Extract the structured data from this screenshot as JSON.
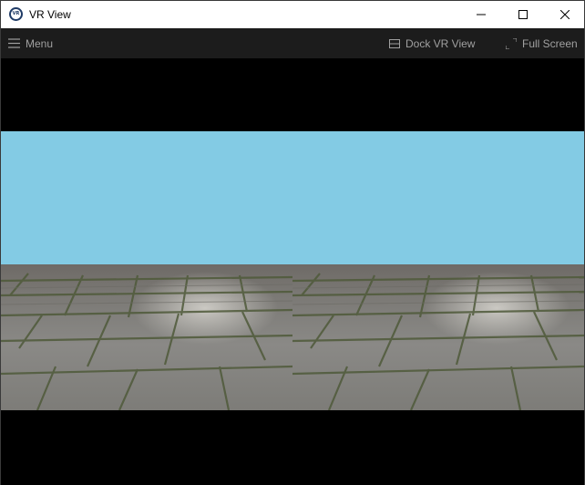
{
  "window": {
    "title": "VR View",
    "icon": "vr-app-icon",
    "icon_text": "VR",
    "controls": {
      "minimize": "minimize-icon",
      "maximize": "maximize-icon",
      "close": "close-icon"
    }
  },
  "toolbar": {
    "menu_label": "Menu",
    "menu_icon": "hamburger-icon",
    "dock_label": "Dock VR View",
    "dock_icon": "dock-icon",
    "fullscreen_label": "Full Screen",
    "fullscreen_icon": "fullscreen-icon"
  },
  "scene": {
    "layout": "side-by-side stereo",
    "eyes": [
      "left",
      "right"
    ],
    "sky_color": "#83cbe4",
    "ground": "stone paving with grass"
  },
  "colors": {
    "titlebar_bg": "#ffffff",
    "toolbar_bg": "#1c1c1c",
    "toolbar_text": "#a0a0a0",
    "viewport_bg": "#000000"
  }
}
